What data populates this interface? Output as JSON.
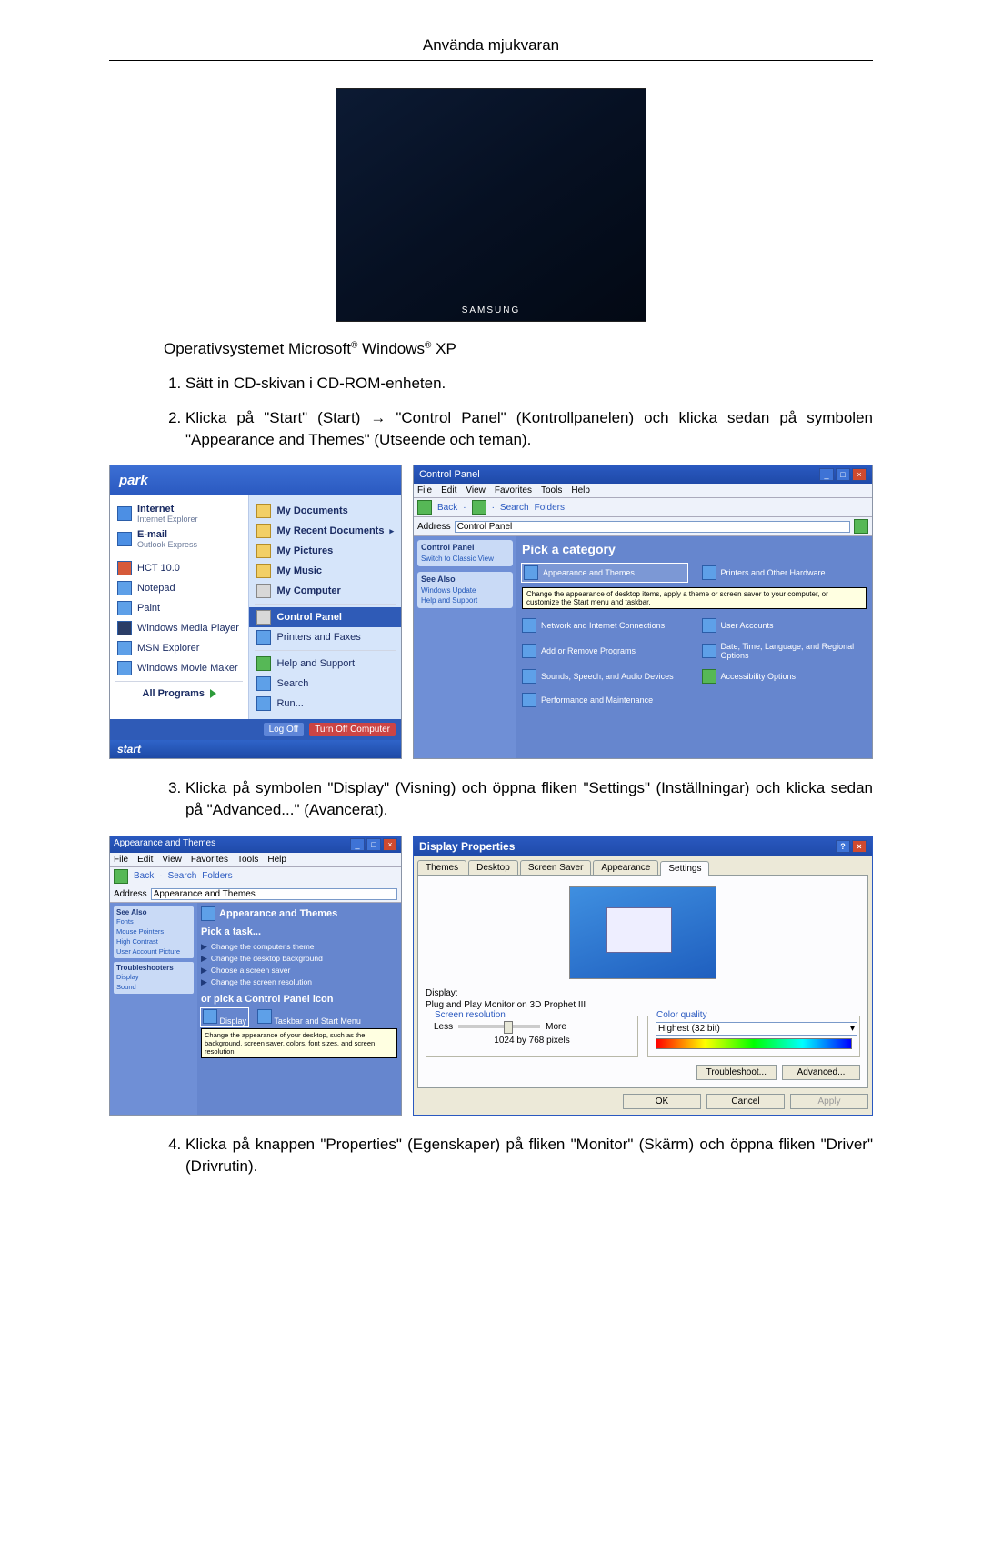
{
  "header": {
    "title": "Använda mjukvaran"
  },
  "monitor": {
    "brand": "SAMSUNG"
  },
  "os_line": {
    "prefix": "Operativsystemet Microsoft",
    "mid": " Windows",
    "tail": " XP"
  },
  "steps": {
    "s1": "Sätt in CD-skivan i CD-ROM-enheten.",
    "s2": "Klicka på \"Start\" (Start) → \"Control Panel\" (Kontrollpanelen) och klicka sedan på symbolen \"Appearance and Themes\" (Utseende och teman).",
    "s3": "Klicka på symbolen \"Display\" (Visning) och öppna fliken \"Settings\" (Inställningar) och klicka sedan på \"Advanced...\" (Avancerat).",
    "s4": "Klicka på knappen \"Properties\" (Egenskaper) på fliken \"Monitor\" (Skärm) och öppna fliken \"Driver\" (Drivrutin)."
  },
  "start_menu": {
    "user": "park",
    "left": {
      "internet": "Internet",
      "internet_sub": "Internet Explorer",
      "email": "E-mail",
      "email_sub": "Outlook Express",
      "hct": "HCT 10.0",
      "notepad": "Notepad",
      "paint": "Paint",
      "wmp": "Windows Media Player",
      "msn": "MSN Explorer",
      "wmm": "Windows Movie Maker",
      "all": "All Programs"
    },
    "right": {
      "mydocs": "My Documents",
      "recent": "My Recent Documents",
      "mypics": "My Pictures",
      "mymusic": "My Music",
      "mycomp": "My Computer",
      "cp": "Control Panel",
      "printers": "Printers and Faxes",
      "help": "Help and Support",
      "search": "Search",
      "run": "Run..."
    },
    "footer": {
      "logoff": "Log Off",
      "turnoff": "Turn Off Computer"
    },
    "taskbar": "start"
  },
  "cp_window": {
    "title": "Control Panel",
    "menu": [
      "File",
      "Edit",
      "View",
      "Favorites",
      "Tools",
      "Help"
    ],
    "toolbar": "Back",
    "toolbar2": "Search",
    "toolbar3": "Folders",
    "address_label": "Address",
    "address_value": "Control Panel",
    "side1_h": "Control Panel",
    "side1_ln": "Switch to Classic View",
    "side2_h": "See Also",
    "side2_ln1": "Windows Update",
    "side2_ln2": "Help and Support",
    "pick": "Pick a category",
    "cats": [
      "Appearance and Themes",
      "Printers and Other Hardware",
      "Network and Internet Connections",
      "User Accounts",
      "Add or Remove Programs",
      "Date, Time, Language, and Regional Options",
      "Sounds, Speech, and Audio Devices",
      "Accessibility Options",
      "Performance and Maintenance"
    ],
    "tooltip": "Change the appearance of desktop items, apply a theme or screen saver to your computer, or customize the Start menu and taskbar."
  },
  "at_window": {
    "title": "Appearance and Themes",
    "menu": [
      "File",
      "Edit",
      "View",
      "Favorites",
      "Tools",
      "Help"
    ],
    "side1_h": "See Also",
    "side1_lns": [
      "Fonts",
      "Mouse Pointers",
      "High Contrast",
      "User Account Picture"
    ],
    "side2_h": "Troubleshooters",
    "side2_lns": [
      "Display",
      "Sound"
    ],
    "header": "Appearance and Themes",
    "task_h": "Pick a task...",
    "tasks": [
      "Change the computer's theme",
      "Change the desktop background",
      "Choose a screen saver",
      "Change the screen resolution"
    ],
    "or_h": "or pick a Control Panel icon",
    "icon_display": "Display",
    "icon_taskbar": "Taskbar and Start Menu",
    "tooltip": "Change the appearance of your desktop, such as the background, screen saver, colors, font sizes, and screen resolution."
  },
  "dp": {
    "title": "Display Properties",
    "tabs": [
      "Themes",
      "Desktop",
      "Screen Saver",
      "Appearance",
      "Settings"
    ],
    "display_label": "Display:",
    "display_value": "Plug and Play Monitor on 3D Prophet III",
    "res_legend": "Screen resolution",
    "res_less": "Less",
    "res_more": "More",
    "res_value": "1024 by 768 pixels",
    "cq_legend": "Color quality",
    "cq_value": "Highest (32 bit)",
    "btn_troubleshoot": "Troubleshoot...",
    "btn_advanced": "Advanced...",
    "btn_ok": "OK",
    "btn_cancel": "Cancel",
    "btn_apply": "Apply"
  }
}
